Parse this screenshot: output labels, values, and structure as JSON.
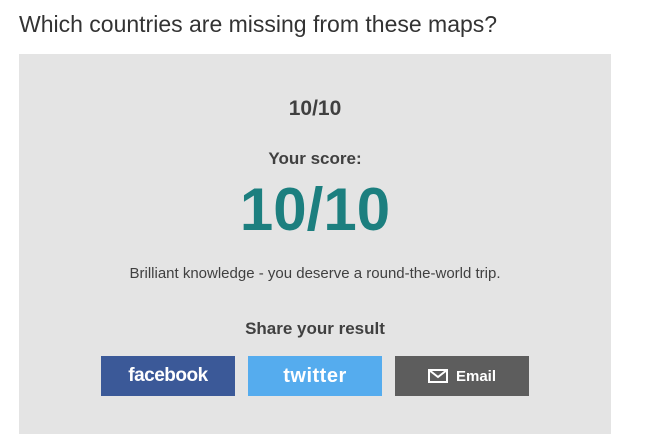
{
  "page": {
    "title": "Which countries are missing from these maps?"
  },
  "result": {
    "progress": "10/10",
    "score_label": "Your score:",
    "score_value": "10/10",
    "message": "Brilliant knowledge - you deserve a round-the-world trip."
  },
  "share": {
    "heading": "Share your result",
    "facebook_label": "facebook",
    "twitter_label": "twitter",
    "email_label": "Email",
    "email_icon": "envelope-icon"
  },
  "colors": {
    "panel_bg": "#e4e4e4",
    "score_accent": "#1c7f7f",
    "facebook": "#3b5998",
    "twitter": "#55acee",
    "email": "#5d5d5d"
  }
}
